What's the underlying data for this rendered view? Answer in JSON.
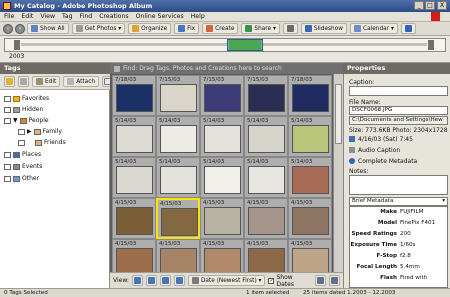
{
  "window": {
    "title": "My Catalog - Adobe Photoshop Album",
    "min": "_",
    "max": "□",
    "close": "X"
  },
  "menu": [
    "File",
    "Edit",
    "View",
    "Tag",
    "Find",
    "Creations",
    "Online Services",
    "Help"
  ],
  "toolbar": {
    "show_all": "Show All",
    "get_photos": "Get Photos",
    "organize": "Organize",
    "fix": "Fix",
    "create": "Create",
    "share": "Share",
    "slideshow": "Slideshow",
    "calendar": "Calendar"
  },
  "timeline": {
    "year_label": "2003"
  },
  "tags": {
    "header": "Tags",
    "edit": "Edit",
    "attach": "Attach",
    "items": [
      {
        "label": "Favorites",
        "icon": "star-icon",
        "color": "#e6b62a"
      },
      {
        "label": "Hidden",
        "icon": "hidden-icon",
        "color": "#9c9c9c"
      },
      {
        "label": "People",
        "icon": "people-icon",
        "color": "#d08a32"
      },
      {
        "label": "Family",
        "icon": "tag-icon",
        "color": "#e7b07a"
      },
      {
        "label": "Friends",
        "icon": "tag-icon",
        "color": "#e7b07a"
      },
      {
        "label": "Places",
        "icon": "places-icon",
        "color": "#3f6fb8"
      },
      {
        "label": "Events",
        "icon": "events-icon",
        "color": "#8a8a8a"
      },
      {
        "label": "Other",
        "icon": "other-icon",
        "color": "#6f9ad3"
      }
    ]
  },
  "find_hint": "Find: Drag Tags, Photos and Creations here to search",
  "photos": [
    {
      "date": "7/18/03",
      "c": "#1a2f66"
    },
    {
      "date": "7/15/03",
      "c": "#d9d5c8"
    },
    {
      "date": "7/15/03",
      "c": "#3c3c7a"
    },
    {
      "date": "7/15/03",
      "c": "#2a2e52"
    },
    {
      "date": "7/18/03",
      "c": "#1e2a60"
    },
    {
      "date": "5/14/03",
      "c": "#dcdad3"
    },
    {
      "date": "5/14/03",
      "c": "#ecebe6"
    },
    {
      "date": "5/14/03",
      "c": "#e3e1da"
    },
    {
      "date": "5/14/03",
      "c": "#d7d4cc"
    },
    {
      "date": "5/14/03",
      "c": "#b9c57a"
    },
    {
      "date": "5/14/03",
      "c": "#dad8d0"
    },
    {
      "date": "5/14/03",
      "c": "#e2e1dc"
    },
    {
      "date": "5/14/03",
      "c": "#f0efe9"
    },
    {
      "date": "5/14/03",
      "c": "#e7e6e1"
    },
    {
      "date": "5/14/03",
      "c": "#a86b55"
    },
    {
      "date": "4/15/03",
      "c": "#7a5f38"
    },
    {
      "date": "4/15/03",
      "c": "#836842"
    },
    {
      "date": "4/15/03",
      "c": "#b8b3a2"
    },
    {
      "date": "4/15/03",
      "c": "#a4948a"
    },
    {
      "date": "4/15/03",
      "c": "#8e7463"
    },
    {
      "date": "4/15/03",
      "c": "#9d6e4b"
    },
    {
      "date": "4/15/03",
      "c": "#a58467"
    },
    {
      "date": "4/15/03",
      "c": "#b08a68"
    },
    {
      "date": "4/15/03",
      "c": "#8b6949"
    },
    {
      "date": "4/15/03",
      "c": "#bea58a"
    }
  ],
  "viewbar": {
    "view": "View:",
    "sort": "Date (Newest First)",
    "show_dates": "Show Dates"
  },
  "props": {
    "header": "Properties",
    "caption_label": "Caption:",
    "file_label": "File Name:",
    "file_name": "DSCF0068.JPG",
    "path": "C:\\Documents and Settings\\Hew",
    "size": "Size: 773.6KB  Photo: 2304x1728",
    "datetime": "4/16/03 (Sat) 7:45",
    "audio": "Audio Caption",
    "complete": "Complete Metadata",
    "notes_label": "Notes:",
    "brief": "Brief Metadata",
    "meta": [
      {
        "k": "Make",
        "v": "FUJIFILM"
      },
      {
        "k": "Model",
        "v": "FinePix F401"
      },
      {
        "k": "Speed Ratings",
        "v": "200"
      },
      {
        "k": "Exposure Time",
        "v": "1/60s"
      },
      {
        "k": "F-Stop",
        "v": "f2.8"
      },
      {
        "k": "Focal Length",
        "v": "5.4mm"
      },
      {
        "k": "Flash",
        "v": "Fired with"
      }
    ]
  },
  "status": {
    "left": "0 Tags Selected",
    "sel": "1 item selected",
    "range": "25 items dated 1.2003 - 12.2003"
  }
}
